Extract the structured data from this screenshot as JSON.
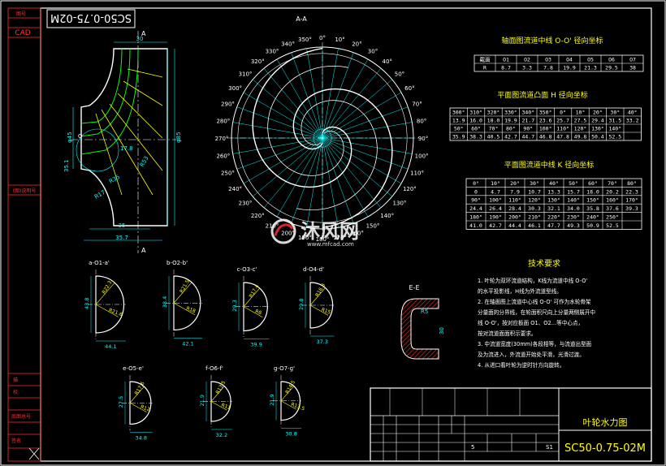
{
  "title_block": {
    "drawing_number": "SC50-0.75-02M",
    "drawing_number_rotated": "SC50-0.75-02M",
    "drawing_title": "叶轮水力图",
    "cad_label": "CAD",
    "sheet_count": "5",
    "sheet_no": "S1"
  },
  "left_strip": {
    "top_label": "图号",
    "mid_label": "(图)说明号",
    "bottom_labels": [
      "描",
      "校",
      "底图总号",
      "",
      "签名"
    ]
  },
  "section_aa": {
    "label": "A-A"
  },
  "meridian": {
    "labels": [
      "A",
      "A",
      "30",
      "φ45",
      "φ85",
      "35.1",
      "17.8",
      "R35",
      "R17",
      "R53",
      "35",
      "35.7",
      "O",
      "0'",
      "1'"
    ]
  },
  "polar_angles": [
    "0°",
    "10°",
    "20°",
    "30°",
    "40°",
    "50°",
    "60°",
    "70°",
    "80°",
    "90°",
    "100°",
    "110°",
    "120°",
    "130°",
    "140°",
    "150°",
    "160°",
    "170°",
    "180°",
    "190°",
    "200°",
    "210°",
    "220°",
    "230°",
    "240°",
    "250°",
    "260°",
    "270°",
    "280°",
    "290°",
    "300°",
    "310°",
    "320°",
    "330°",
    "340°",
    "350°"
  ],
  "table1": {
    "title": "轴面图流道中线 O-O' 径向坐标",
    "rows": [
      [
        "截面",
        "O1",
        "O2",
        "O3",
        "O4",
        "O5",
        "O6",
        "O7"
      ],
      [
        "R",
        "8.7",
        "3.3",
        "7.8",
        "19.9",
        "21.3",
        "29.5",
        "38"
      ]
    ]
  },
  "table2": {
    "title": "平面图流道凸面 H 径向坐标",
    "rows": [
      [
        "300°",
        "310°",
        "320°",
        "330°",
        "340°",
        "350°",
        "0°",
        "10°",
        "20°",
        "30°",
        "40°"
      ],
      [
        "13.9",
        "16.0",
        "18.0",
        "19.9",
        "21.7",
        "23.6",
        "25.7",
        "27.5",
        "29.4",
        "31.5",
        "33.2"
      ],
      [
        "50°",
        "60°",
        "70°",
        "80°",
        "90°",
        "100°",
        "110°",
        "120°",
        "130°",
        "140°",
        ""
      ],
      [
        "35.9",
        "38.3",
        "40.5",
        "42.7",
        "44.7",
        "46.8",
        "47.8",
        "49.8",
        "50.4",
        "52.5",
        ""
      ]
    ]
  },
  "table3": {
    "title": "平面图流道中线 K 径向坐标",
    "rows": [
      [
        "0°",
        "10°",
        "20°",
        "30°",
        "40°",
        "50°",
        "60°",
        "70°",
        "80°"
      ],
      [
        "0",
        "4.7",
        "7.9",
        "10.7",
        "13.3",
        "15.7",
        "18.0",
        "20.2",
        "22.3"
      ],
      [
        "90°",
        "100°",
        "110°",
        "120°",
        "130°",
        "140°",
        "150°",
        "160°",
        "170°"
      ],
      [
        "24.4",
        "26.4",
        "28.4",
        "30.3",
        "32.1",
        "34.0",
        "35.8",
        "37.6",
        "39.3"
      ],
      [
        "180°",
        "190°",
        "200°",
        "210°",
        "220°",
        "230°",
        "240°",
        "250°",
        ""
      ],
      [
        "41.0",
        "42.7",
        "44.4",
        "46.1",
        "47.7",
        "49.3",
        "50.9",
        "52.5",
        ""
      ]
    ]
  },
  "tech_notes": {
    "title": "技术要求",
    "items": [
      "1. 叶轮为双环流道结构，K线为流道中线 O-O'",
      "   的水平投影线，H线为外流道型线。",
      "2. 在轴面图上流道中心线 O-O' 可作为水轮骨架",
      "   分量面的分界线，在轮面积尺向上分量两侧展开中",
      "   线 O-O'，按对应板面 O1、O2…等中心点，",
      "   按对流道面面积示要求。",
      "3. 中流道宽度(30mm)各段相等，与流道出型面",
      "   及为流进入，外流道开始处平滑，光滑过渡。",
      "4. 从进口看叶轮为逆时针方向旋转。"
    ]
  },
  "sections": [
    {
      "label": "a-O1-a'",
      "w": "44.1",
      "h": "43.8",
      "r1": "R22.3",
      "r2": "R21.6"
    },
    {
      "label": "b-O2-b'",
      "w": "42.1",
      "h": "38.4",
      "r1": "R21.5",
      "r2": "R18"
    },
    {
      "label": "c-O3-c'",
      "w": "39.9",
      "h": "29.3",
      "r1": "R17.4",
      "r2": "R8"
    },
    {
      "label": "d-O4-d'",
      "w": "37.3",
      "h": "29.8",
      "r1": "R16.8",
      "r2": "R15"
    },
    {
      "label": "e-O5-e'",
      "w": "34.8",
      "h": "27.5",
      "r1": "R17.6",
      "r2": "R12"
    },
    {
      "label": "f-O6-f'",
      "w": "32.2",
      "h": "21.9",
      "r1": "R13.5",
      "r2": "R11"
    },
    {
      "label": "g-O7-g'",
      "w": "30.8",
      "h": "21.9",
      "r1": "R14.5",
      "r2": "R13.5"
    }
  ],
  "section_ee": {
    "label": "E-E",
    "r": "R5",
    "dim": "30"
  },
  "watermark": {
    "main": "沐风网",
    "sub": "www.mfcad.com"
  }
}
